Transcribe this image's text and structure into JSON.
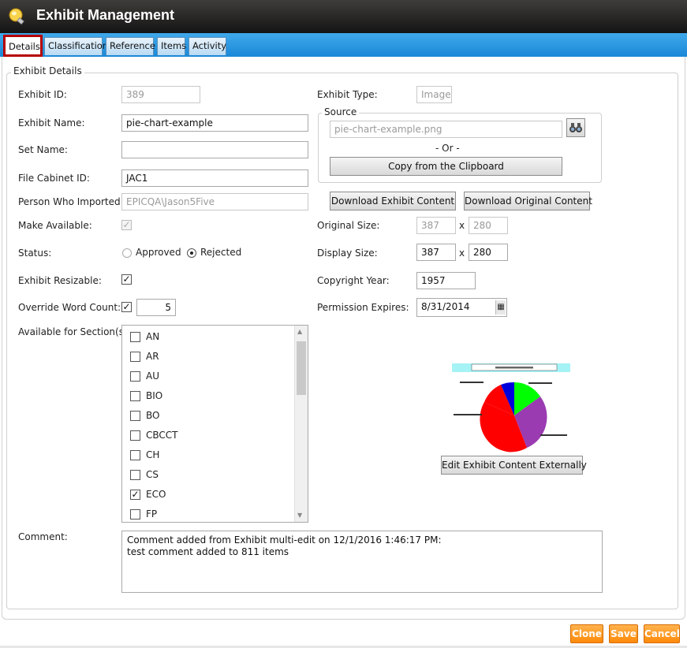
{
  "app": {
    "title": "Exhibit Management"
  },
  "tabs": [
    "Details",
    "Classification",
    "Reference",
    "Items",
    "Activity"
  ],
  "details": {
    "group_title": "Exhibit Details",
    "exhibit_id_label": "Exhibit ID:",
    "exhibit_id": "389",
    "exhibit_name_label": "Exhibit Name:",
    "exhibit_name": "pie-chart-example",
    "set_name_label": "Set Name:",
    "set_name": "",
    "file_cabinet_label": "File Cabinet ID:",
    "file_cabinet_id": "JAC1",
    "person_label": "Person Who Imported:",
    "person": "EPICQA\\Jason5Five",
    "make_available_label": "Make Available:",
    "make_available": true,
    "status_label": "Status:",
    "status_options": [
      "Approved",
      "Rejected"
    ],
    "status_selected": "Rejected",
    "resizable_label": "Exhibit Resizable:",
    "resizable": true,
    "override_label": "Override Word Count:",
    "override": true,
    "word_count": "5",
    "sections_label": "Available for Section(s)",
    "sections": [
      {
        "label": "AN",
        "checked": false
      },
      {
        "label": "AR",
        "checked": false
      },
      {
        "label": "AU",
        "checked": false
      },
      {
        "label": "BIO",
        "checked": false
      },
      {
        "label": "BO",
        "checked": false
      },
      {
        "label": "CBCCT",
        "checked": false
      },
      {
        "label": "CH",
        "checked": false
      },
      {
        "label": "CS",
        "checked": false
      },
      {
        "label": "ECO",
        "checked": true
      },
      {
        "label": "FP",
        "checked": false
      }
    ],
    "comment_label": "Comment:",
    "comment": "Comment added from Exhibit multi-edit on 12/1/2016 1:46:17 PM:\ntest comment added to 811 items"
  },
  "right": {
    "exhibit_type_label": "Exhibit Type:",
    "exhibit_type": "Image",
    "source_title": "Source",
    "source_file": "pie-chart-example.png",
    "or_text": "- Or -",
    "clipboard_button": "Copy from the Clipboard",
    "download_exhibit_button": "Download Exhibit Content",
    "download_original_button": "Download Original Content",
    "original_size_label": "Original Size:",
    "original_w": "387",
    "original_h": "280",
    "display_size_label": "Display Size:",
    "display_w": "387",
    "display_h": "280",
    "x_sep": "x",
    "copyright_label": "Copyright Year:",
    "copyright_year": "1957",
    "permission_label": "Permission Expires:",
    "permission_date": "8/31/2014",
    "edit_external_button": "Edit Exhibit Content Externally",
    "preview_icon": "pie-chart-thumbnail"
  },
  "footer": {
    "clone": "Clone",
    "save": "Save",
    "cancel": "Cancel"
  },
  "colors": {
    "accent_tab_border": "#b50000",
    "footer_button": "#ff8a0a",
    "tabbar": "#1b88d8"
  }
}
